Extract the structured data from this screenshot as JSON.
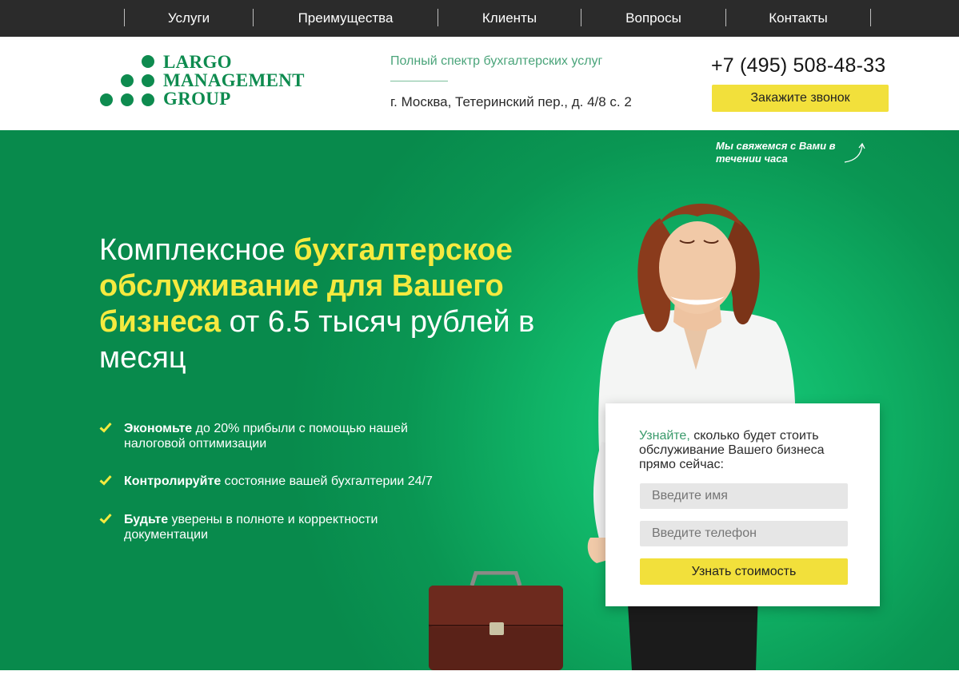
{
  "nav": {
    "items": [
      {
        "label": "Услуги"
      },
      {
        "label": "Преимущества"
      },
      {
        "label": "Клиенты"
      },
      {
        "label": "Вопросы"
      },
      {
        "label": "Контакты"
      }
    ]
  },
  "header": {
    "logo": {
      "line1": "LARGO",
      "line2": "MANAGEMENT",
      "line3": "GROUP"
    },
    "tagline": "Полный спектр бухгалтерских услуг",
    "address": "г. Москва, Тетеринский пер., д. 4/8 с. 2",
    "phone": "+7 (495) 508-48-33",
    "callback_label": "Закажите звонок"
  },
  "hero": {
    "callback_note": "Мы свяжемся с Вами в течении часа",
    "headline": {
      "part1": "Комплексное ",
      "part2": "бухгалтерское обслуживание для Вашего бизнеса",
      "part3": " от 6.5 тысяч рублей в месяц"
    },
    "benefits": [
      {
        "bold": "Экономьте",
        "rest": " до 20% прибыли с помощью нашей налоговой оптимизации"
      },
      {
        "bold": "Контролируйте",
        "rest": " состояние вашей бухгалтерии 24/7"
      },
      {
        "bold": "Будьте",
        "rest": " уверены в полноте и корректности документации"
      }
    ]
  },
  "form": {
    "title_accent": "Узнайте,",
    "title_rest": " сколько будет стоить обслуживание Вашего бизнеса прямо сейчас:",
    "name_placeholder": "Введите имя",
    "phone_placeholder": "Введите телефон",
    "submit_label": "Узнать стоимость"
  },
  "colors": {
    "nav_bg": "#2b2b2b",
    "brand_green": "#0e8b4f",
    "hero_green": "#10b467",
    "accent_yellow": "#f2e03b",
    "headline_yellow": "#f5ea3f"
  },
  "icons": {
    "benefit_marker": "check-icon",
    "note_marker": "arrow-icon"
  }
}
